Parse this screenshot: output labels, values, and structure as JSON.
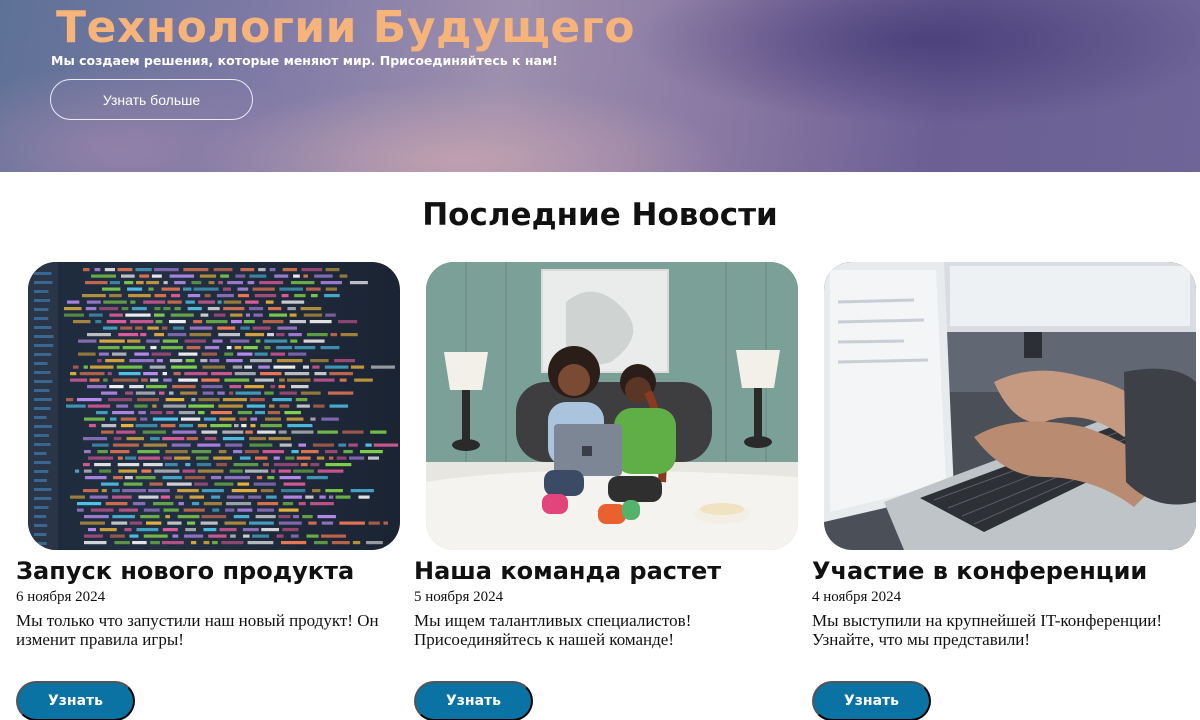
{
  "hero": {
    "title": "Технологии Будущего",
    "subtitle": "Мы создаем решения, которые меняют мир. Присоединяйтесь к нам!",
    "button_label": "Узнать больше",
    "title_color": "#f6b37a"
  },
  "news": {
    "heading": "Последние Новости",
    "button_color": "#0b73a3",
    "cards": [
      {
        "image": "code-screen-photo",
        "title": "Запуск нового продукта",
        "date": "6 ноября 2024",
        "text": "Мы только что запустили наш новый продукт! Он изменит правила игры!",
        "button_label": "Узнать"
      },
      {
        "image": "team-on-bed-laptop-photo",
        "title": "Наша команда растет",
        "date": "5 ноября 2024",
        "text": "Мы ищем талантливых специалистов! Присоединяйтесь к нашей команде!",
        "button_label": "Узнать"
      },
      {
        "image": "typing-laptop-photo",
        "title": "Участие в конференции",
        "date": "4 ноября 2024",
        "text": "Мы выступили на крупнейшей IT-конференции! Узнайте, что мы представили!",
        "button_label": "Узнать"
      }
    ]
  }
}
